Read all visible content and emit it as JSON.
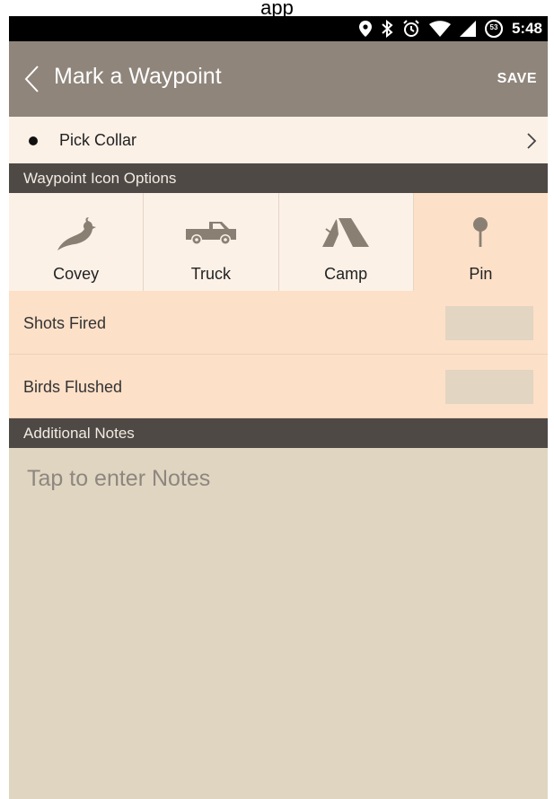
{
  "caption": "app",
  "status_bar": {
    "time": "5:48",
    "battery": "53",
    "icons": [
      "location-icon",
      "bluetooth-icon",
      "alarm-icon",
      "wifi-icon",
      "signal-icon",
      "battery-icon"
    ]
  },
  "app_bar": {
    "title": "Mark a Waypoint",
    "save_label": "SAVE",
    "background": "#8f857b"
  },
  "collar": {
    "label": "Pick Collar"
  },
  "waypoint_icons": {
    "header": "Waypoint Icon Options",
    "options": [
      {
        "label": "Covey",
        "icon": "quail-icon",
        "selected": false
      },
      {
        "label": "Truck",
        "icon": "truck-icon",
        "selected": false
      },
      {
        "label": "Camp",
        "icon": "tent-icon",
        "selected": false
      },
      {
        "label": "Pin",
        "icon": "pin-icon",
        "selected": true
      }
    ]
  },
  "fields": {
    "shots_fired": {
      "label": "Shots Fired",
      "value": ""
    },
    "birds_flushed": {
      "label": "Birds Flushed",
      "value": ""
    }
  },
  "notes": {
    "header": "Additional Notes",
    "placeholder": "Tap to enter Notes"
  },
  "colors": {
    "accent": "#fde0c8",
    "header_dark": "#4f4946",
    "icon_brown": "#8a7f73",
    "notes_bg": "#e0d5c0"
  }
}
